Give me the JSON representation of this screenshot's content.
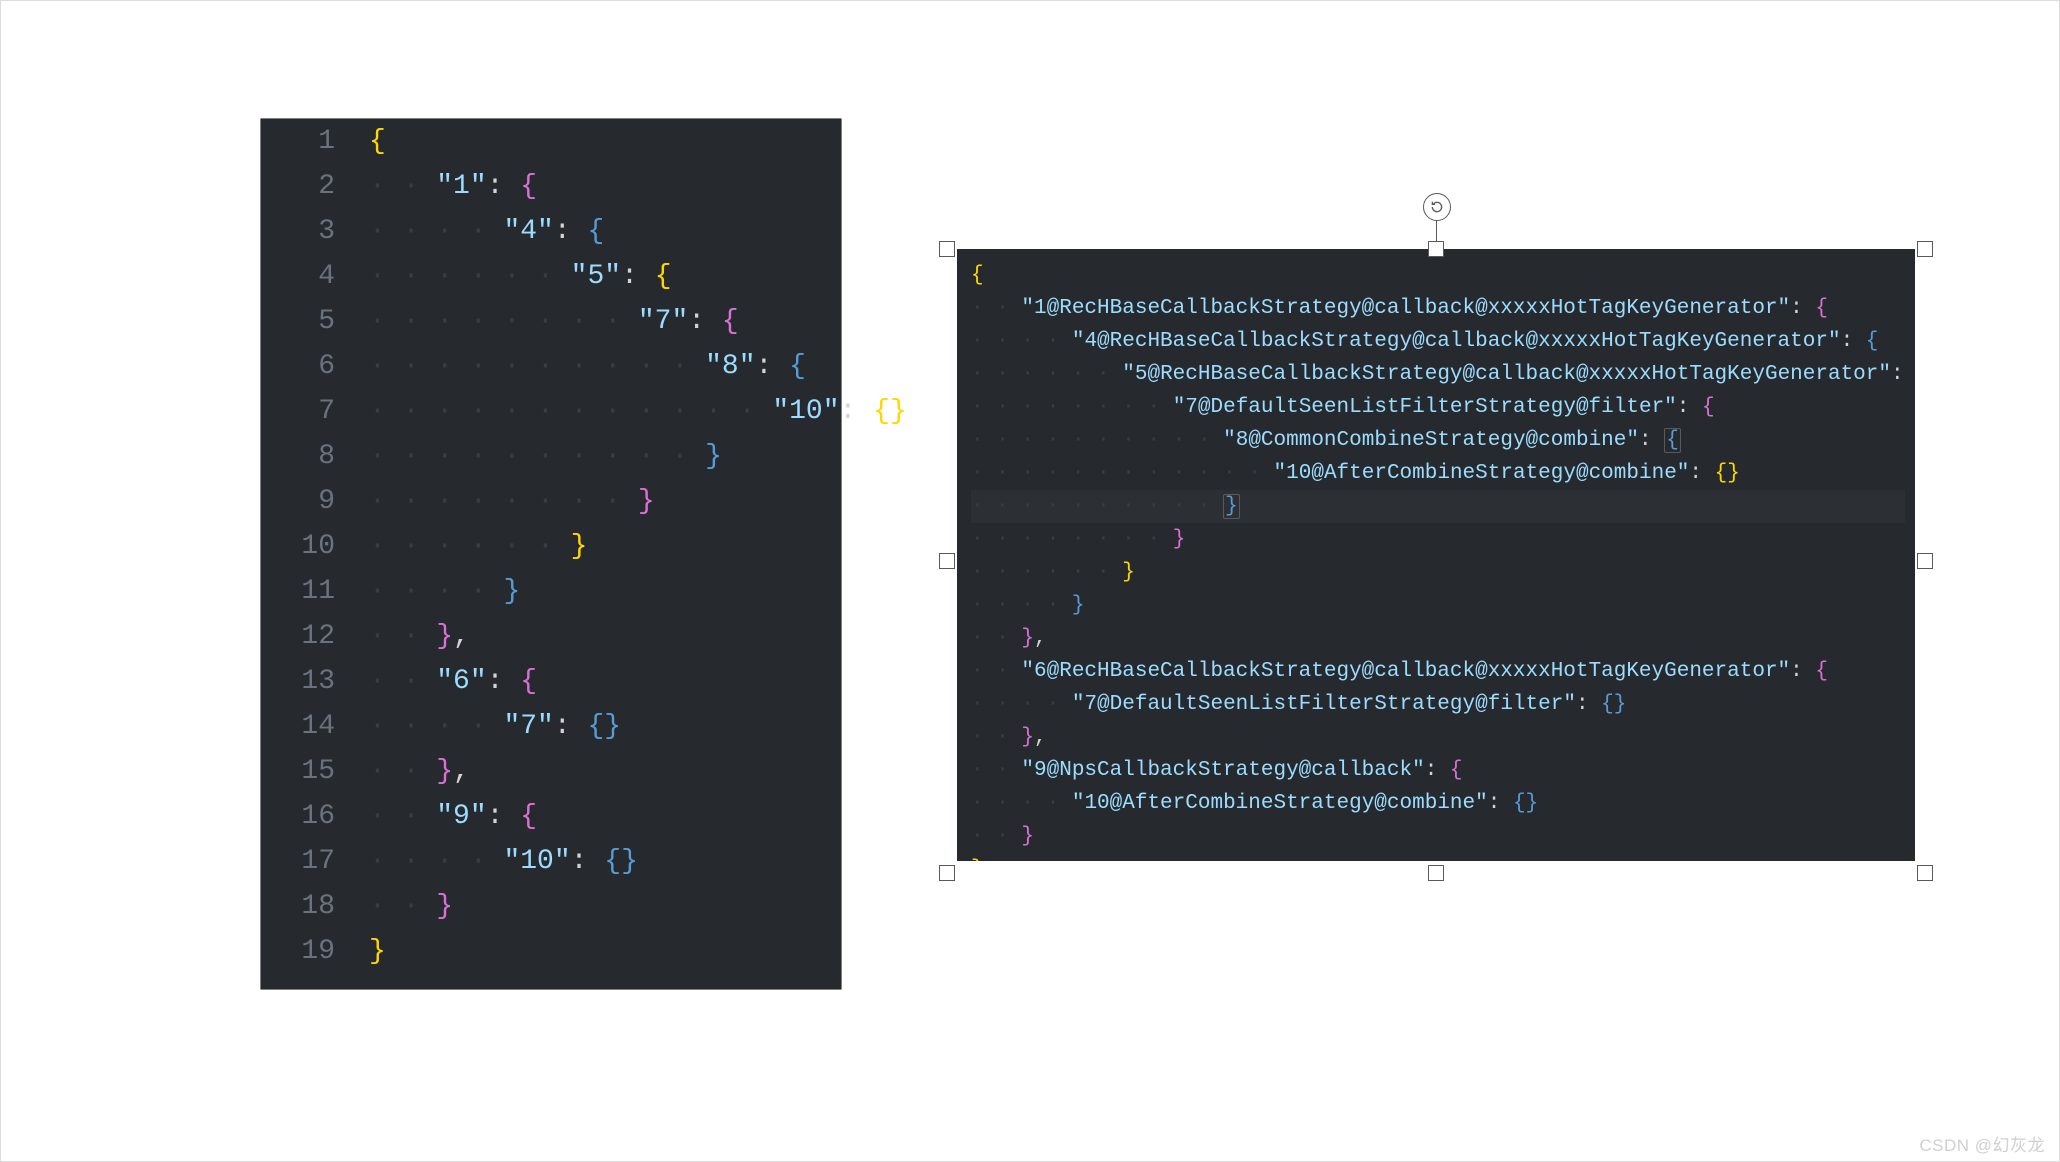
{
  "left_editor": {
    "line_count": 19,
    "lines": [
      {
        "indent": 0,
        "tokens": [
          {
            "t": "{",
            "c": "b0"
          }
        ]
      },
      {
        "indent": 1,
        "tokens": [
          {
            "t": "\"1\"",
            "c": "t-key"
          },
          {
            "t": ": ",
            "c": "t-punc"
          },
          {
            "t": "{",
            "c": "b1"
          }
        ]
      },
      {
        "indent": 2,
        "tokens": [
          {
            "t": "\"4\"",
            "c": "t-key"
          },
          {
            "t": ": ",
            "c": "t-punc"
          },
          {
            "t": "{",
            "c": "b2"
          }
        ]
      },
      {
        "indent": 3,
        "tokens": [
          {
            "t": "\"5\"",
            "c": "t-key"
          },
          {
            "t": ": ",
            "c": "t-punc"
          },
          {
            "t": "{",
            "c": "b3"
          }
        ]
      },
      {
        "indent": 4,
        "tokens": [
          {
            "t": "\"7\"",
            "c": "t-key"
          },
          {
            "t": ": ",
            "c": "t-punc"
          },
          {
            "t": "{",
            "c": "b4"
          }
        ]
      },
      {
        "indent": 5,
        "tokens": [
          {
            "t": "\"8\"",
            "c": "t-key"
          },
          {
            "t": ": ",
            "c": "t-punc"
          },
          {
            "t": "{",
            "c": "b5"
          }
        ]
      },
      {
        "indent": 6,
        "tokens": [
          {
            "t": "\"10\"",
            "c": "t-key"
          },
          {
            "t": ": ",
            "c": "t-punc"
          },
          {
            "t": "{}",
            "c": "b6"
          }
        ]
      },
      {
        "indent": 5,
        "tokens": [
          {
            "t": "}",
            "c": "b5"
          }
        ]
      },
      {
        "indent": 4,
        "tokens": [
          {
            "t": "}",
            "c": "b4"
          }
        ]
      },
      {
        "indent": 3,
        "tokens": [
          {
            "t": "}",
            "c": "b3"
          }
        ]
      },
      {
        "indent": 2,
        "tokens": [
          {
            "t": "}",
            "c": "b2"
          }
        ]
      },
      {
        "indent": 1,
        "tokens": [
          {
            "t": "}",
            "c": "b1"
          },
          {
            "t": ",",
            "c": "t-punc"
          }
        ]
      },
      {
        "indent": 1,
        "tokens": [
          {
            "t": "\"6\"",
            "c": "t-key"
          },
          {
            "t": ": ",
            "c": "t-punc"
          },
          {
            "t": "{",
            "c": "b1"
          }
        ]
      },
      {
        "indent": 2,
        "tokens": [
          {
            "t": "\"7\"",
            "c": "t-key"
          },
          {
            "t": ": ",
            "c": "t-punc"
          },
          {
            "t": "{}",
            "c": "b2"
          }
        ]
      },
      {
        "indent": 1,
        "tokens": [
          {
            "t": "}",
            "c": "b1"
          },
          {
            "t": ",",
            "c": "t-punc"
          }
        ]
      },
      {
        "indent": 1,
        "tokens": [
          {
            "t": "\"9\"",
            "c": "t-key"
          },
          {
            "t": ": ",
            "c": "t-punc"
          },
          {
            "t": "{",
            "c": "b1"
          }
        ]
      },
      {
        "indent": 2,
        "tokens": [
          {
            "t": "\"10\"",
            "c": "t-key"
          },
          {
            "t": ": ",
            "c": "t-punc"
          },
          {
            "t": "{}",
            "c": "b2"
          }
        ]
      },
      {
        "indent": 1,
        "tokens": [
          {
            "t": "}",
            "c": "b1"
          }
        ]
      },
      {
        "indent": 0,
        "tokens": [
          {
            "t": "}",
            "c": "b0"
          }
        ]
      }
    ]
  },
  "right_editor": {
    "highlight_row": 7,
    "lines": [
      {
        "indent": 0,
        "tokens": [
          {
            "t": "{",
            "c": "b0"
          }
        ]
      },
      {
        "indent": 1,
        "tokens": [
          {
            "t": "\"1@RecHBaseCallbackStrategy@callback@xxxxxHotTagKeyGenerator\"",
            "c": "t-key"
          },
          {
            "t": ": ",
            "c": "t-punc"
          },
          {
            "t": "{",
            "c": "b1"
          }
        ]
      },
      {
        "indent": 2,
        "tokens": [
          {
            "t": "\"4@RecHBaseCallbackStrategy@callback@xxxxxHotTagKeyGenerator\"",
            "c": "t-key"
          },
          {
            "t": ": ",
            "c": "t-punc"
          },
          {
            "t": "{",
            "c": "b2"
          }
        ]
      },
      {
        "indent": 3,
        "tokens": [
          {
            "t": "\"5@RecHBaseCallbackStrategy@callback@xxxxxHotTagKeyGenerator\"",
            "c": "t-key"
          },
          {
            "t": ": ",
            "c": "t-punc"
          },
          {
            "t": "{",
            "c": "b3"
          }
        ]
      },
      {
        "indent": 4,
        "tokens": [
          {
            "t": "\"7@DefaultSeenListFilterStrategy@filter\"",
            "c": "t-key"
          },
          {
            "t": ": ",
            "c": "t-punc"
          },
          {
            "t": "{",
            "c": "b4"
          }
        ]
      },
      {
        "indent": 5,
        "tokens": [
          {
            "t": "\"8@CommonCombineStrategy@combine\"",
            "c": "t-key"
          },
          {
            "t": ": ",
            "c": "t-punc"
          },
          {
            "t": "{",
            "c": "b5 cur-br"
          }
        ]
      },
      {
        "indent": 6,
        "tokens": [
          {
            "t": "\"10@AfterCombineStrategy@combine\"",
            "c": "t-key"
          },
          {
            "t": ": ",
            "c": "t-punc"
          },
          {
            "t": "{}",
            "c": "b6"
          }
        ]
      },
      {
        "indent": 5,
        "hl": true,
        "tokens": [
          {
            "t": "}",
            "c": "b5 cur-br"
          }
        ]
      },
      {
        "indent": 4,
        "tokens": [
          {
            "t": "}",
            "c": "b4"
          }
        ]
      },
      {
        "indent": 3,
        "tokens": [
          {
            "t": "}",
            "c": "b3"
          }
        ]
      },
      {
        "indent": 2,
        "tokens": [
          {
            "t": "}",
            "c": "b2"
          }
        ]
      },
      {
        "indent": 1,
        "tokens": [
          {
            "t": "}",
            "c": "b1"
          },
          {
            "t": ",",
            "c": "t-punc"
          }
        ]
      },
      {
        "indent": 1,
        "tokens": [
          {
            "t": "\"6@RecHBaseCallbackStrategy@callback@xxxxxHotTagKeyGenerator\"",
            "c": "t-key"
          },
          {
            "t": ": ",
            "c": "t-punc"
          },
          {
            "t": "{",
            "c": "b1"
          }
        ]
      },
      {
        "indent": 2,
        "tokens": [
          {
            "t": "\"7@DefaultSeenListFilterStrategy@filter\"",
            "c": "t-key"
          },
          {
            "t": ": ",
            "c": "t-punc"
          },
          {
            "t": "{}",
            "c": "b2"
          }
        ]
      },
      {
        "indent": 1,
        "tokens": [
          {
            "t": "}",
            "c": "b1"
          },
          {
            "t": ",",
            "c": "t-punc"
          }
        ]
      },
      {
        "indent": 1,
        "tokens": [
          {
            "t": "\"9@NpsCallbackStrategy@callback\"",
            "c": "t-key"
          },
          {
            "t": ": ",
            "c": "t-punc"
          },
          {
            "t": "{",
            "c": "b1"
          }
        ]
      },
      {
        "indent": 2,
        "tokens": [
          {
            "t": "\"10@AfterCombineStrategy@combine\"",
            "c": "t-key"
          },
          {
            "t": ": ",
            "c": "t-punc"
          },
          {
            "t": "{}",
            "c": "b2"
          }
        ]
      },
      {
        "indent": 1,
        "tokens": [
          {
            "t": "}",
            "c": "b1"
          }
        ]
      },
      {
        "indent": 0,
        "tokens": [
          {
            "t": "}",
            "c": "b0"
          }
        ]
      }
    ]
  },
  "colors": {
    "editor_bg": "#262a2f",
    "line_num": "#6a737d",
    "key": "#9cdcfe",
    "brace_yellow": "#ffd700",
    "brace_orchid": "#da70d6",
    "brace_blue": "#569cd6",
    "whitespace_dot": "#3c3c3c"
  },
  "watermark": "CSDN @幻灰龙"
}
